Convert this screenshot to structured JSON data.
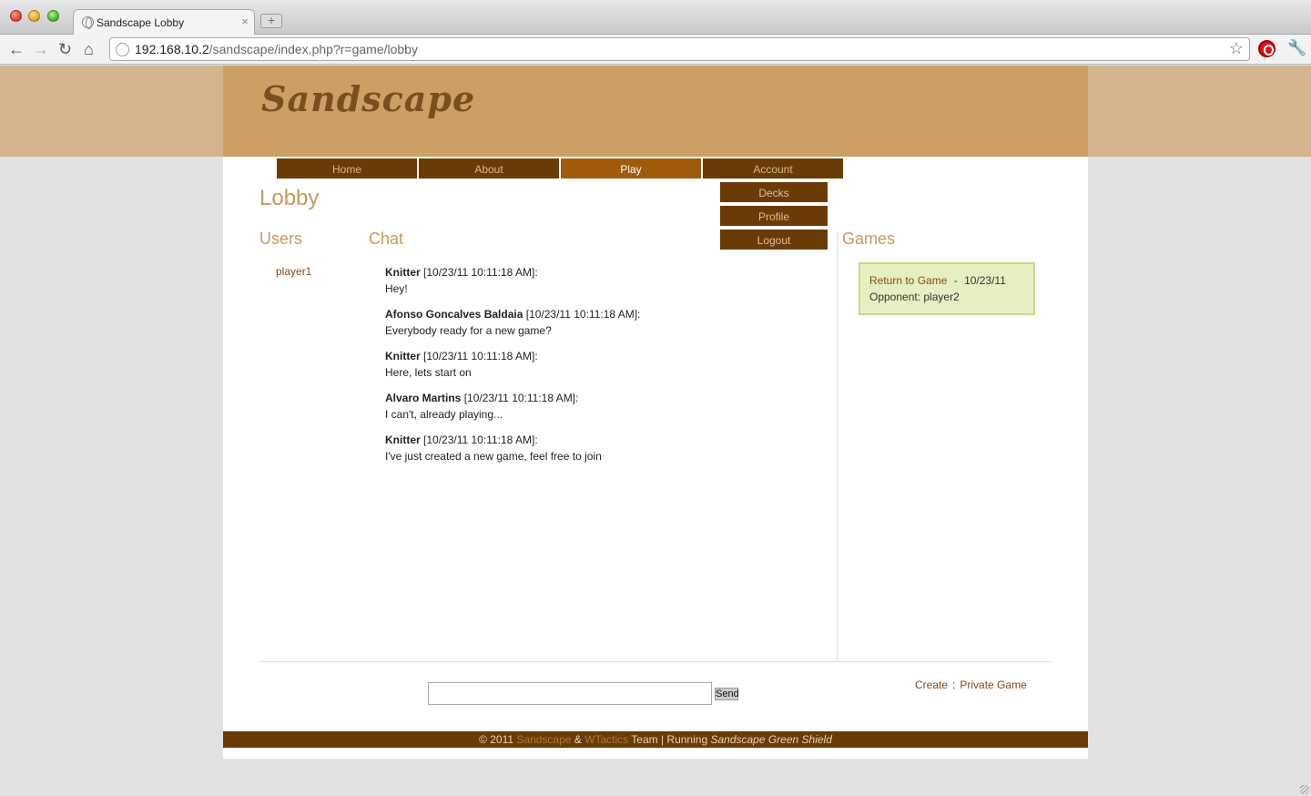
{
  "browser": {
    "tab_title": "Sandscape Lobby",
    "tab_close": "×",
    "new_tab": "+",
    "url_host": "192.168.10.2",
    "url_path": "/sandscape/index.php?r=game/lobby",
    "back": "←",
    "forward": "→",
    "reload": "↻",
    "home": "⌂",
    "star": "☆",
    "wrench": "🔧"
  },
  "site": {
    "logo": "Sandscape",
    "colors": {
      "header": "#cc9f64",
      "menu": "#6b3b06",
      "menu_active": "#a05a0a",
      "accent": "#c9995d",
      "link": "#8a4a10"
    }
  },
  "nav": {
    "items": [
      {
        "label": "Home"
      },
      {
        "label": "About"
      },
      {
        "label": "Play"
      },
      {
        "label": "Account"
      }
    ],
    "active": "Play",
    "account_submenu": [
      {
        "label": "Decks"
      },
      {
        "label": "Profile"
      },
      {
        "label": "Logout"
      }
    ]
  },
  "lobby": {
    "title": "Lobby",
    "users_heading": "Users",
    "chat_heading": "Chat",
    "games_heading": "Games",
    "users": [
      "player1"
    ],
    "messages": [
      {
        "author": "Knitter",
        "time": "[10/23/11 10:11:18 AM]:",
        "text": "Hey!"
      },
      {
        "author": "Afonso Goncalves Baldaia",
        "time": "[10/23/11 10:11:18 AM]:",
        "text": "Everybody ready for a new game?"
      },
      {
        "author": "Knitter",
        "time": "[10/23/11 10:11:18 AM]:",
        "text": "Here, lets start on"
      },
      {
        "author": "Alvaro Martins",
        "time": "[10/23/11 10:11:18 AM]:",
        "text": "I can't, already playing..."
      },
      {
        "author": "Knitter",
        "time": "[10/23/11 10:11:18 AM]:",
        "text": "I've just created a new game, feel free to join"
      }
    ],
    "game": {
      "link": "Return to Game",
      "separator": "-",
      "date": "10/23/11",
      "opponent": "Opponent: player2"
    },
    "send_label": "Send",
    "chat_input_value": "",
    "create_label": "Create",
    "links_separator": ":",
    "private_game_label": "Private Game"
  },
  "footer": {
    "copyright": "© 2011",
    "sandscape": "Sandscape",
    "amp": "&",
    "wtactics": "WTactics",
    "team": "Team",
    "running": "| Running",
    "theme": "Sandscape Green Shield"
  }
}
